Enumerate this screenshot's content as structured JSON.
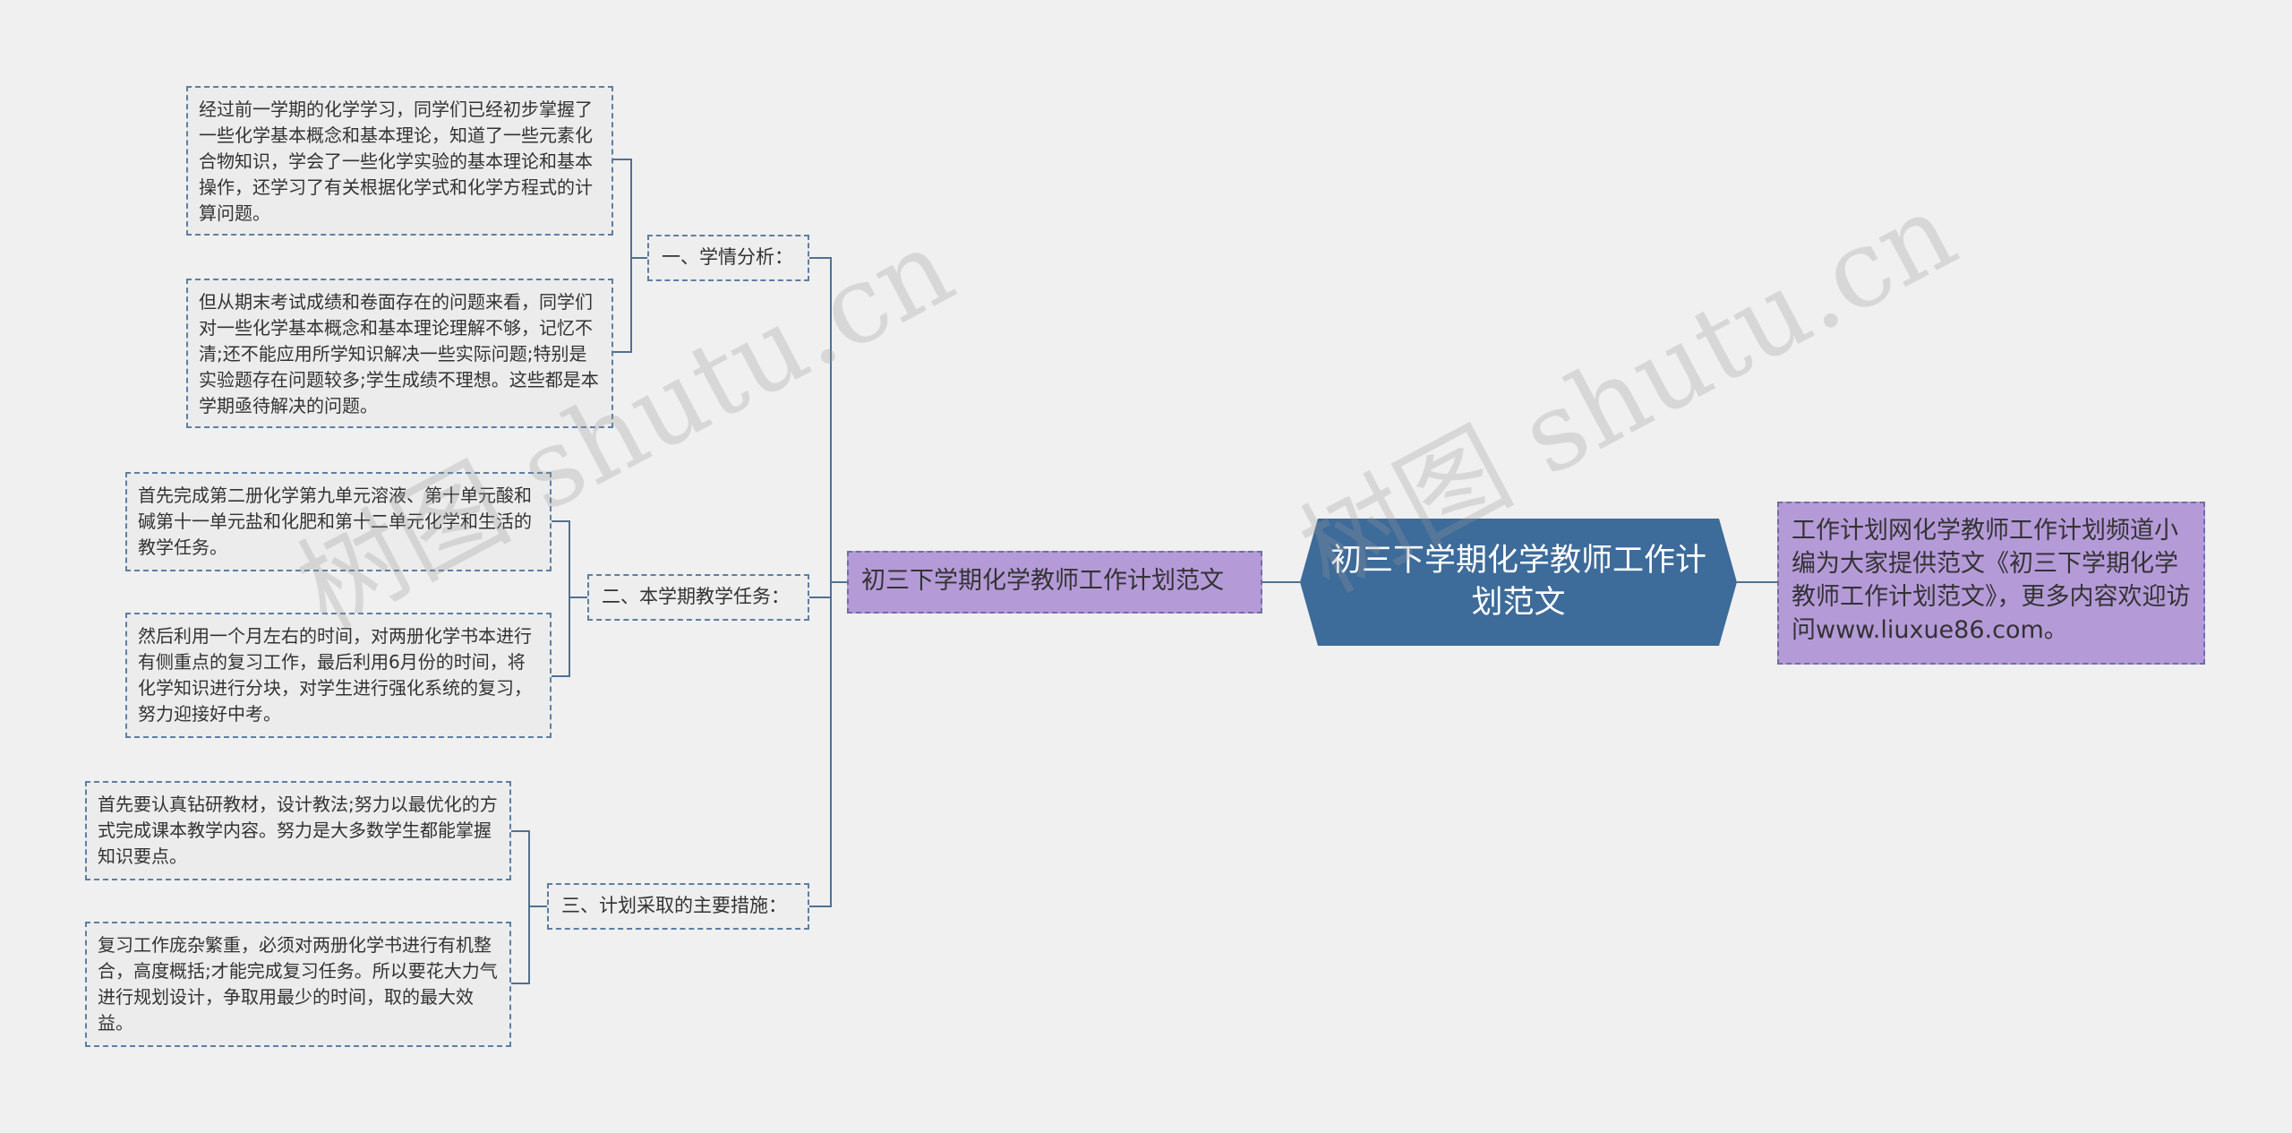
{
  "root": {
    "label": "初三下学期化学教师工作计划范文"
  },
  "note": {
    "text": "工作计划网化学教师工作计划频道小编为大家提供范文《初三下学期化学教师工作计划范文》，更多内容欢迎访问www.liuxue86.com。"
  },
  "branch": {
    "label": "初三下学期化学教师工作计划范文"
  },
  "sections": [
    {
      "label": "一、学情分析：",
      "items": [
        "经过前一学期的化学学习，同学们已经初步掌握了一些化学基本概念和基本理论，知道了一些元素化合物知识，学会了一些化学实验的基本理论和基本操作，还学习了有关根据化学式和化学方程式的计算问题。",
        "但从期末考试成绩和卷面存在的问题来看，同学们对一些化学基本概念和基本理论理解不够，记忆不清;还不能应用所学知识解决一些实际问题;特别是实验题存在问题较多;学生成绩不理想。这些都是本学期亟待解决的问题。"
      ]
    },
    {
      "label": "二、本学期教学任务：",
      "items": [
        "首先完成第二册化学第九单元溶液、第十单元酸和碱第十一单元盐和化肥和第十二单元化学和生活的教学任务。",
        "然后利用一个月左右的时间，对两册化学书本进行有侧重点的复习工作，最后利用6月份的时间，将化学知识进行分块，对学生进行强化系统的复习，努力迎接好中考。"
      ]
    },
    {
      "label": "三、计划采取的主要措施：",
      "items": [
        "首先要认真钻研教材，设计教法;努力以最优化的方式完成课本教学内容。努力是大多数学生都能掌握知识要点。",
        "复习工作庞杂繁重，必须对两册化学书进行有机整合，高度概括;才能完成复习任务。所以要花大力气进行规划设计，争取用最少的时间，取的最大效益。"
      ]
    }
  ],
  "watermarks": [
    "树图 shutu.cn",
    "树图 shutu.cn"
  ],
  "colors": {
    "root_fill": "#3d6b9a",
    "line": "#4f7193",
    "purple_fill": "#b59ad8",
    "leaf_fill": "#ececec",
    "background": "#f0f0f0"
  }
}
